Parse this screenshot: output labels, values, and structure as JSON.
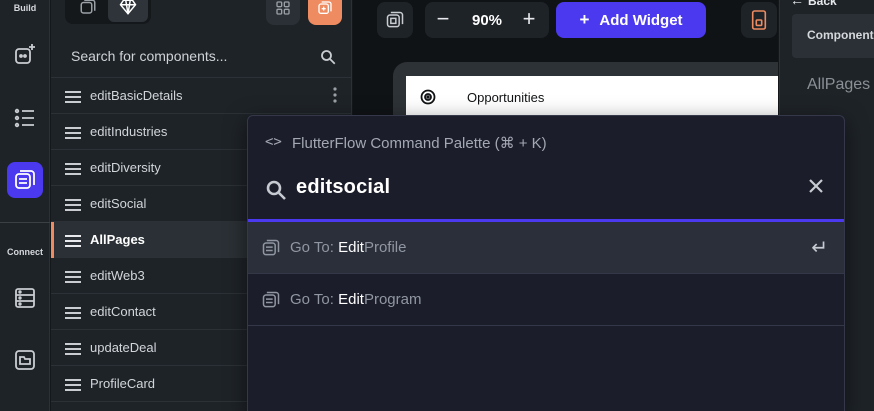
{
  "rail": {
    "build_label": "Build",
    "connect_label": "Connect"
  },
  "panel": {
    "search_placeholder": "Search for components...",
    "items": [
      {
        "label": "editBasicDetails"
      },
      {
        "label": "editIndustries"
      },
      {
        "label": "editDiversity"
      },
      {
        "label": "editSocial"
      },
      {
        "label": "AllPages",
        "active": true
      },
      {
        "label": "editWeb3"
      },
      {
        "label": "editContact"
      },
      {
        "label": "updateDeal"
      },
      {
        "label": "ProfileCard"
      }
    ]
  },
  "toolbar": {
    "zoom_minus": "−",
    "zoom_value": "90%",
    "zoom_plus": "+",
    "add_widget_label": "Add Widget",
    "add_widget_plus": "+"
  },
  "canvas": {
    "list_item_label": "Opportunities"
  },
  "right_panel": {
    "back_label": "Back",
    "header_label": "Component",
    "item_label": "AllPages"
  },
  "palette": {
    "title_icon": "<>",
    "title": "FlutterFlow Command Palette (⌘ + K)",
    "query": "editsocial",
    "results": [
      {
        "prefix": "Go To: ",
        "match": "Edit",
        "rest": "Profile",
        "enter_glyph": "↵"
      },
      {
        "prefix": "Go To: ",
        "match": "Edit",
        "rest": "Program"
      }
    ]
  },
  "colors": {
    "accent": "#4b39ef",
    "highlight": "#ee8b60",
    "background": "#14181b",
    "panel": "#1e2328"
  }
}
